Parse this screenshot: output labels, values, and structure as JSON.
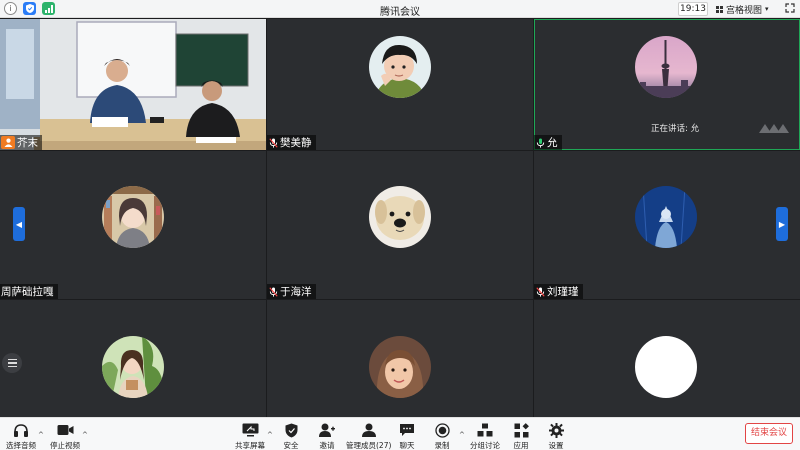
{
  "window": {
    "title": "腾讯会议",
    "time": "19:13",
    "view_mode": "宫格视图"
  },
  "participants": [
    {
      "name": "芥末",
      "mic": "host"
    },
    {
      "name": "樊美静",
      "mic": "muted"
    },
    {
      "name": "允",
      "mic": "active"
    },
    {
      "name": "周萨础拉嘎",
      "mic": "none"
    },
    {
      "name": "于海洋",
      "mic": "muted"
    },
    {
      "name": "刘瑾瑾",
      "mic": "muted"
    },
    {
      "name": "",
      "mic": "none"
    },
    {
      "name": "",
      "mic": "none"
    },
    {
      "name": "",
      "mic": "none"
    }
  ],
  "speaking_label": "正在讲话: 允",
  "toolbar": {
    "audio": "选择音频",
    "video": "停止视频",
    "share": "共享屏幕",
    "security": "安全",
    "invite": "邀请",
    "members": "管理成员(27)",
    "chat": "聊天",
    "record": "录制",
    "breakout": "分组讨论",
    "apps": "应用",
    "settings": "设置",
    "end": "结束会议"
  },
  "colors": {
    "accent": "#1e6ddb",
    "speaking_border": "#1fa756",
    "host_badge": "#f07b22",
    "end_button": "#e24545"
  }
}
